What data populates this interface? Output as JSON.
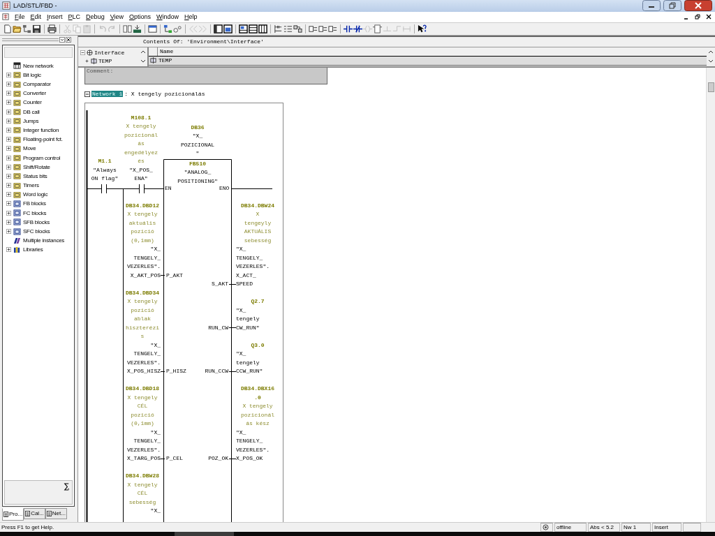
{
  "window": {
    "title": "LAD/STL/FBD -"
  },
  "menu": [
    "File",
    "Edit",
    "Insert",
    "PLC",
    "Debug",
    "View",
    "Options",
    "Window",
    "Help"
  ],
  "toolbar": [
    {
      "kind": "new",
      "disabled": false
    },
    {
      "kind": "open",
      "disabled": false
    },
    {
      "kind": "network",
      "disabled": false
    },
    {
      "kind": "save",
      "disabled": false
    },
    {
      "kind": "sep"
    },
    {
      "kind": "print",
      "disabled": false
    },
    {
      "kind": "sep"
    },
    {
      "kind": "cut",
      "disabled": true
    },
    {
      "kind": "copy",
      "disabled": true
    },
    {
      "kind": "paste",
      "disabled": true
    },
    {
      "kind": "sep"
    },
    {
      "kind": "undo",
      "disabled": true
    },
    {
      "kind": "redo",
      "disabled": true
    },
    {
      "kind": "sep"
    },
    {
      "kind": "compare",
      "disabled": false
    },
    {
      "kind": "download",
      "disabled": false
    },
    {
      "kind": "sep"
    },
    {
      "kind": "overview",
      "disabled": false
    },
    {
      "kind": "sep"
    },
    {
      "kind": "nodes",
      "disabled": false
    },
    {
      "kind": "address",
      "disabled": false
    },
    {
      "kind": "sep"
    },
    {
      "kind": "prev",
      "disabled": true
    },
    {
      "kind": "next",
      "disabled": true
    },
    {
      "kind": "sep"
    },
    {
      "kind": "pane",
      "disabled": false
    },
    {
      "kind": "detail",
      "disabled": false
    },
    {
      "kind": "sep"
    },
    {
      "kind": "split",
      "disabled": false
    },
    {
      "kind": "rows",
      "disabled": false
    },
    {
      "kind": "columns",
      "disabled": false
    },
    {
      "kind": "sep"
    },
    {
      "kind": "ladder",
      "disabled": false
    },
    {
      "kind": "list",
      "disabled": false
    },
    {
      "kind": "blocks",
      "disabled": false
    },
    {
      "kind": "sep"
    },
    {
      "kind": "display",
      "disabled": false
    },
    {
      "kind": "display",
      "disabled": false
    },
    {
      "kind": "display",
      "disabled": false
    },
    {
      "kind": "sep"
    },
    {
      "kind": "contact",
      "disabled": false
    },
    {
      "kind": "contact_nc",
      "disabled": false
    },
    {
      "kind": "coil",
      "disabled": true
    },
    {
      "kind": "box",
      "disabled": false
    },
    {
      "kind": "branch_open",
      "disabled": true
    },
    {
      "kind": "branch_close",
      "disabled": true
    },
    {
      "kind": "connection",
      "disabled": true
    },
    {
      "kind": "sep"
    },
    {
      "kind": "help",
      "disabled": false
    }
  ],
  "catalog": {
    "items": [
      {
        "label": "New network",
        "kind": "network",
        "expandable": false
      },
      {
        "label": "Bit logic",
        "kind": "folder",
        "expandable": true
      },
      {
        "label": "Comparator",
        "kind": "folder",
        "expandable": true
      },
      {
        "label": "Converter",
        "kind": "folder",
        "expandable": true
      },
      {
        "label": "Counter",
        "kind": "folder",
        "expandable": true
      },
      {
        "label": "DB call",
        "kind": "folder",
        "expandable": true
      },
      {
        "label": "Jumps",
        "kind": "folder",
        "expandable": true
      },
      {
        "label": "Integer function",
        "kind": "folder",
        "expandable": true
      },
      {
        "label": "Floating-point fct.",
        "kind": "folder",
        "expandable": true
      },
      {
        "label": "Move",
        "kind": "folder",
        "expandable": true
      },
      {
        "label": "Program control",
        "kind": "folder",
        "expandable": true
      },
      {
        "label": "Shift/Rotate",
        "kind": "folder",
        "expandable": true
      },
      {
        "label": "Status bits",
        "kind": "folder",
        "expandable": true
      },
      {
        "label": "Timers",
        "kind": "folder",
        "expandable": true
      },
      {
        "label": "Word logic",
        "kind": "folder",
        "expandable": true
      },
      {
        "label": "FB blocks",
        "kind": "block",
        "expandable": true
      },
      {
        "label": "FC blocks",
        "kind": "block",
        "expandable": true
      },
      {
        "label": "SFB blocks",
        "kind": "block",
        "expandable": true
      },
      {
        "label": "SFC blocks",
        "kind": "block",
        "expandable": true
      },
      {
        "label": "Multiple instances",
        "kind": "instances",
        "expandable": false
      },
      {
        "label": "Libraries",
        "kind": "library",
        "expandable": true
      }
    ],
    "tabs": [
      {
        "label": "Pro...",
        "selected": true
      },
      {
        "label": "Cal...",
        "selected": false
      },
      {
        "label": "Net...",
        "selected": false
      }
    ]
  },
  "interface": {
    "heading": "Contents Of: 'Environment\\Interface'",
    "tree": [
      {
        "label": "Interface",
        "expanded": true,
        "children": [
          {
            "label": "TEMP",
            "expanded": false
          }
        ]
      }
    ],
    "columns": [
      "Name"
    ],
    "rows": [
      {
        "name": "TEMP"
      }
    ]
  },
  "editor": {
    "comment_label": "Comment:",
    "network": {
      "label": "Network 1",
      "title": ": X tengely pozicionálás",
      "expanded": true,
      "contacts": [
        {
          "address": [
            "M1.1"
          ],
          "symbol": [
            "\"Always",
            "ON flag\""
          ]
        },
        {
          "address": [
            "M108.1"
          ],
          "comment": [
            "X tengely",
            "pozicionál",
            "ás",
            "engedélyez",
            "és"
          ],
          "symbol": [
            "\"X_POS_",
            "ENA\""
          ]
        }
      ],
      "block": {
        "instance": {
          "address": [
            "DB36"
          ],
          "symbol": [
            "\"X_",
            "POZICIONAL",
            "\""
          ]
        },
        "number": "FB510",
        "name": [
          "\"ANALOG_",
          "POSITIONING\""
        ],
        "enable_in": "EN",
        "enable_out": "ENO"
      },
      "inputs": [
        {
          "pin": "P_AKT",
          "address": [
            "DB34.DBD12"
          ],
          "comment": [
            "X tengely",
            "aktuális",
            "pozició",
            "(0,1mm)"
          ],
          "symbol": [
            "\"X_",
            "TENGELY_",
            "VEZERLES\".",
            "X_AKT_POS"
          ]
        },
        {
          "pin": "P_HISZ",
          "address": [
            "DB34.DBD34"
          ],
          "comment": [
            "X tengely",
            "pozició",
            "ablak",
            "hiszterézi",
            "s"
          ],
          "symbol": [
            "\"X_",
            "TENGELY_",
            "VEZERLES\".",
            "X_POS_HISZ"
          ]
        },
        {
          "pin": "P_CEL",
          "address": [
            "DB34.DBD18"
          ],
          "comment": [
            "X tengely",
            "CÉL",
            "pozició",
            "(0,1mm)"
          ],
          "symbol": [
            "\"X_",
            "TENGELY_",
            "VEZERLES\".",
            "X_TARG_POS"
          ]
        },
        {
          "address": [
            "DB34.DBW28"
          ],
          "comment": [
            "X tengely",
            "CÉL",
            "sebesség"
          ],
          "symbol": [
            "\"X_"
          ]
        }
      ],
      "outputs": [
        {
          "pin": "S_AKT",
          "address": [
            "DB34.DBW24"
          ],
          "comment": [
            "X",
            "tengeyly",
            "AKTUÁLIS",
            "sebesség"
          ],
          "symbol": [
            "\"X_",
            "TENGELY_",
            "VEZERLES\".",
            "X_ACT_",
            "SPEED"
          ]
        },
        {
          "pin": "RUN_CW",
          "address": [
            "Q2.7"
          ],
          "symbol": [
            "\"X_",
            "tengely",
            "CW_RUN\""
          ]
        },
        {
          "pin": "RUN_CCW",
          "address": [
            "Q3.0"
          ],
          "symbol": [
            "\"X_",
            "tengely",
            "CCW_RUN\""
          ]
        },
        {
          "pin": "POZ_OK",
          "address": [
            "DB34.DBX16",
            ".0"
          ],
          "comment": [
            "X tengely",
            "pozicionál",
            "ás kész"
          ],
          "symbol": [
            "\"X_",
            "TENGELY_",
            "VEZERLES\".",
            "X_POS_OK"
          ]
        }
      ]
    }
  },
  "status_bar": {
    "help": "Press F1 to get Help.",
    "mode": "offline",
    "version": "Abs < 5.2",
    "network": "Nw 1",
    "input_mode": "Insert"
  }
}
